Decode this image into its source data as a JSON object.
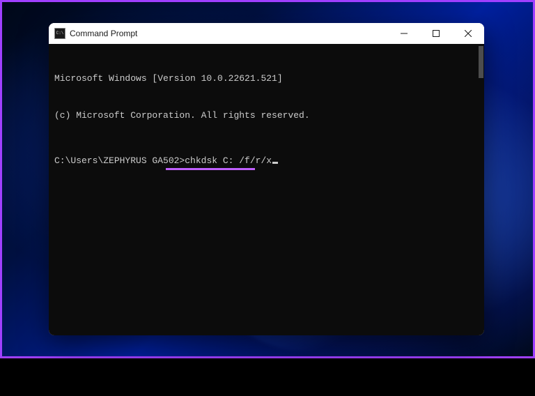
{
  "window": {
    "title": "Command Prompt"
  },
  "terminal": {
    "line1": "Microsoft Windows [Version 10.0.22621.521]",
    "line2": "(c) Microsoft Corporation. All rights reserved.",
    "prompt": "C:\\Users\\ZEPHYRUS GA502>",
    "command": "chkdsk C: /f/r/x",
    "highlight_color": "#c060ff"
  },
  "controls": {
    "minimize": "minimize",
    "maximize": "maximize",
    "close": "close"
  }
}
